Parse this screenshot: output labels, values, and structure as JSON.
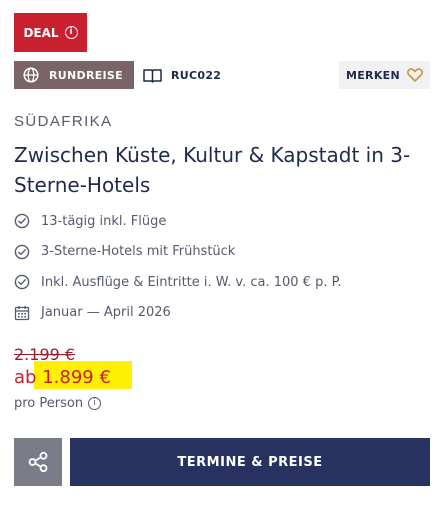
{
  "badges": {
    "deal_label": "DEAL",
    "deal_info_glyph": "i",
    "trip_type": "RUNDREISE",
    "trip_code": "RUC022"
  },
  "actions": {
    "merken_label": "MERKEN",
    "cta_label": "TERMINE & PREISE"
  },
  "offer": {
    "country": "SÜDAFRIKA",
    "title": "Zwischen Küste, Kultur & Kapstadt in 3-Sterne-Hotels",
    "features": [
      "13-tägig inkl. Flüge",
      "3-Sterne-Hotels mit Frühstück",
      "Inkl. Ausflüge & Eintritte i. W. v. ca. 100 € p. P."
    ],
    "period": "Januar — April 2026"
  },
  "pricing": {
    "old_price": "2.199 €",
    "price_prefix": "ab",
    "price": "1.899 €",
    "per_person": "pro Person",
    "info_glyph": "i"
  },
  "icons": {
    "deal": "info-circle-icon",
    "trip_type": "globe-icon",
    "trip_code": "book-icon",
    "merken": "heart-icon",
    "features": "check-circle-icon",
    "period": "calendar-icon",
    "share": "share-icon"
  },
  "colors": {
    "deal_red": "#c8202f",
    "tag_mauve": "#7a6468",
    "navy": "#273261",
    "highlight_yellow": "#ffef00",
    "heart_gold": "#c9963c"
  }
}
